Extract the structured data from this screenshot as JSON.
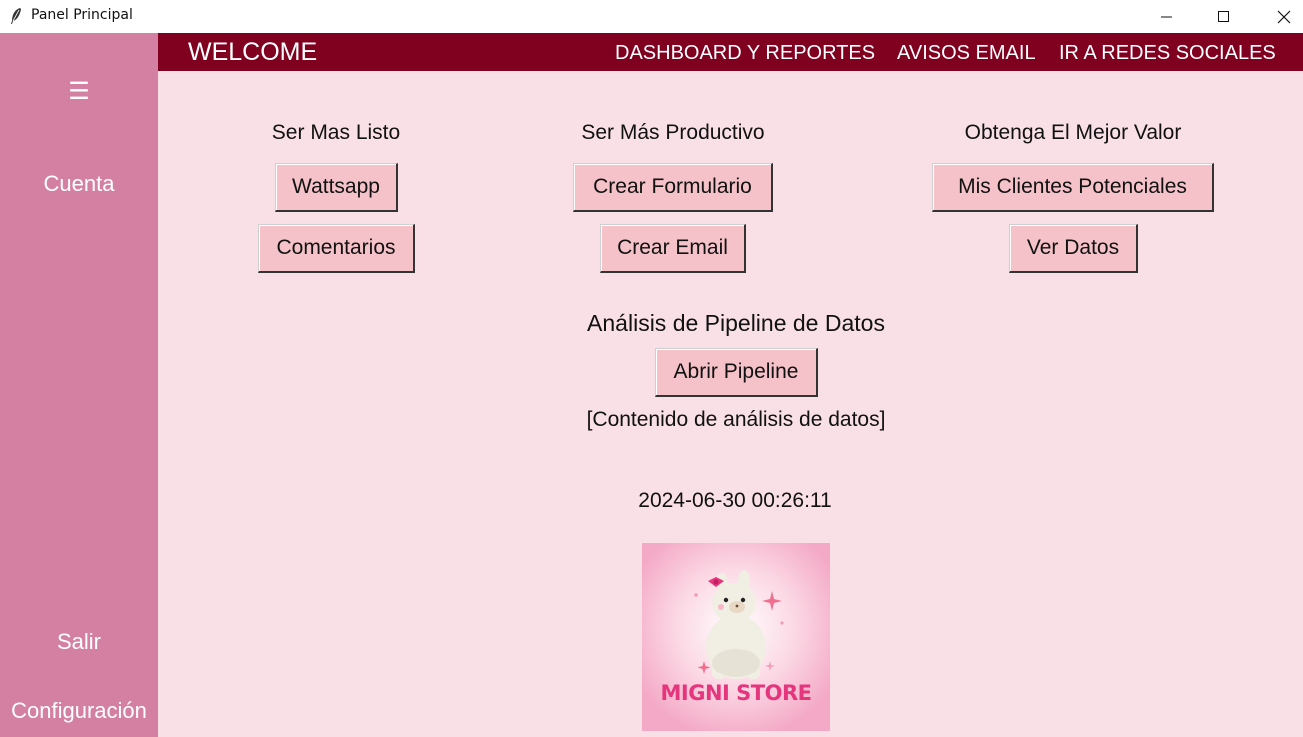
{
  "window": {
    "title": "Panel Principal",
    "controls": [
      "minimize-icon",
      "maximize-icon",
      "close-icon"
    ],
    "icon": "feather-icon"
  },
  "sidebar": {
    "menu_icon": "☰",
    "account": "Cuenta",
    "exit": "Salir",
    "settings": "Configuración",
    "bg_color": "#d480a2"
  },
  "topbar": {
    "welcome": "WELCOME",
    "nav": [
      "DASHBOARD Y REPORTES",
      "AVISOS EMAIL",
      "IR A REDES SOCIALES"
    ],
    "bg_color": "#800020"
  },
  "sections": [
    {
      "title": "Ser Mas Listo",
      "buttons": [
        "Wattsapp",
        "Comentarios"
      ]
    },
    {
      "title": "Ser Más Productivo",
      "buttons": [
        "Crear Formulario",
        "Crear Email"
      ]
    },
    {
      "title": "Obtenga El Mejor Valor",
      "buttons": [
        "Mis Clientes Potenciales",
        "Ver Datos"
      ]
    }
  ],
  "pipeline": {
    "title": "Análisis de Pipeline de Datos",
    "button": "Abrir Pipeline",
    "content": "[Contenido de análisis de datos]"
  },
  "datetime": "2024-06-30 00:26:11",
  "logo": {
    "text": "MIGNI STORE",
    "icon": "llama-logo"
  },
  "colors": {
    "content_bg": "#f8e0e6",
    "button_bg": "#f4c2c8"
  }
}
